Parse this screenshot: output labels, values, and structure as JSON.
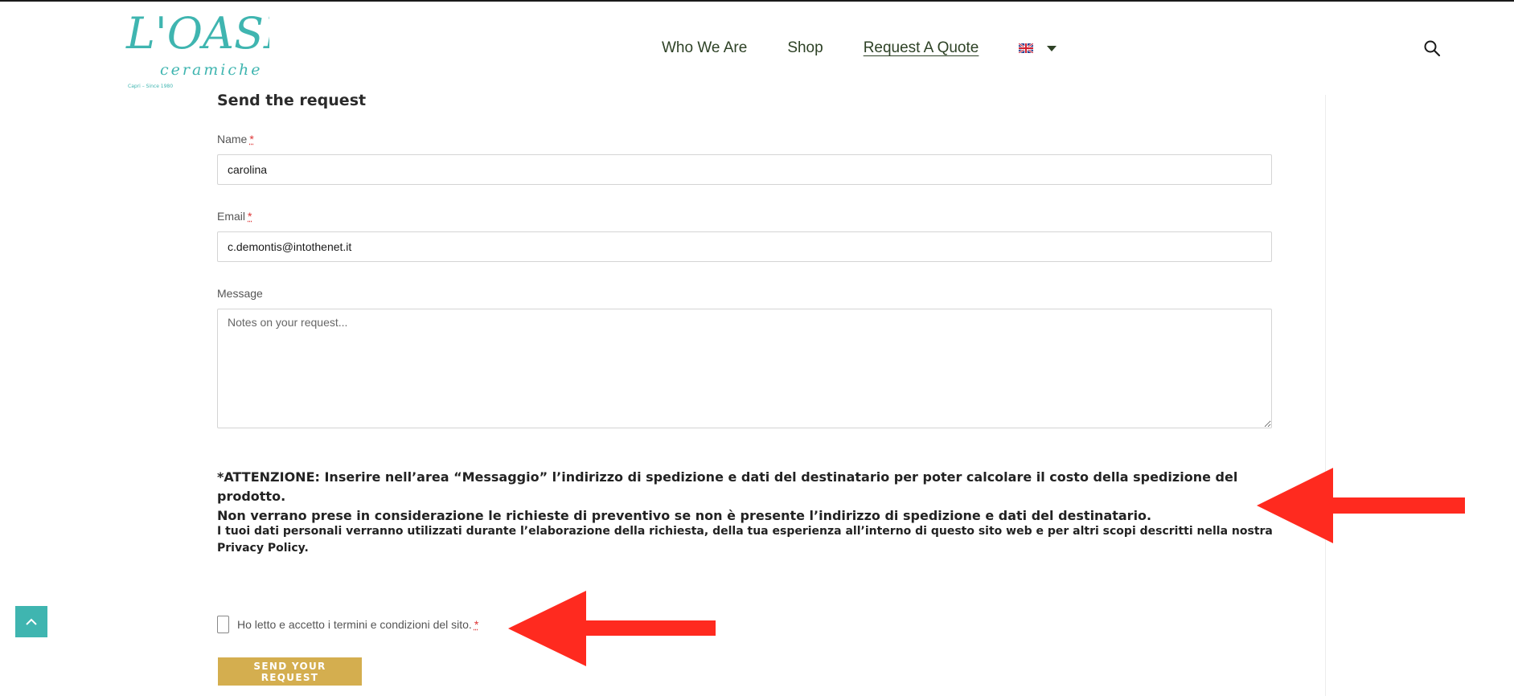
{
  "brand": {
    "logo_main": "L'OASI",
    "logo_sub": "ceramiche",
    "logo_tagline": "Capri – Since 1980",
    "logo_color": "#3fb5b0"
  },
  "nav": {
    "items": [
      {
        "label": "Who We Are"
      },
      {
        "label": "Shop"
      },
      {
        "label": "Request A Quote",
        "active": true
      }
    ],
    "language_flag_icon": "uk-flag-icon",
    "search_icon": "search-icon"
  },
  "form": {
    "title": "Send the request",
    "name": {
      "label": "Name",
      "required_mark": "*",
      "value": "carolina"
    },
    "email": {
      "label": "Email",
      "required_mark": "*",
      "value": "c.demontis@intothenet.it"
    },
    "message": {
      "label": "Message",
      "placeholder": "Notes on your request..."
    },
    "attention_line1": "*ATTENZIONE: Inserire nell’area “Messaggio” l’indirizzo di spedizione e dati del destinatario per poter calcolare il costo della spedizione del prodotto.",
    "attention_line2": "Non verrano prese in considerazione le richieste di preventivo se non è presente l’indirizzo di spedizione e dati del destinatario.",
    "privacy_text": "I tuoi dati personali verranno utilizzati durante l’elaborazione della richiesta, della tua esperienza all’interno di questo sito web e per altri scopi descritti nella nostra",
    "privacy_link": "Privacy Policy.",
    "terms_label": "Ho letto e accetto i termini e condizioni del sito.",
    "terms_required_mark": "*",
    "submit_label": "SEND YOUR REQUEST"
  },
  "colors": {
    "accent": "#d4ae4f",
    "teal": "#3fb5b0",
    "nav_text": "#2e4226",
    "annotation_arrow": "#ff2a1f"
  }
}
